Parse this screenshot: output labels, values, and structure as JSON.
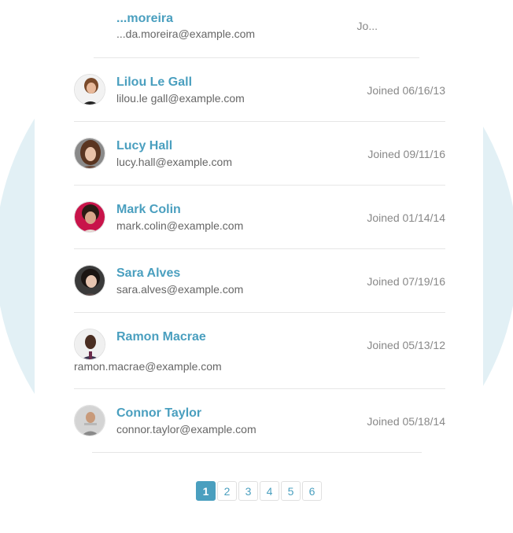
{
  "users": [
    {
      "name": "...moreira",
      "email": "...da.moreira@example.com",
      "joined": "Jo..."
    },
    {
      "name": "Lilou Le Gall",
      "email": "lilou.le gall@example.com",
      "joined": "Joined 06/16/13"
    },
    {
      "name": "Lucy Hall",
      "email": "lucy.hall@example.com",
      "joined": "Joined 09/11/16"
    },
    {
      "name": "Mark Colin",
      "email": "mark.colin@example.com",
      "joined": "Joined 01/14/14"
    },
    {
      "name": "Sara Alves",
      "email": "sara.alves@example.com",
      "joined": "Joined 07/19/16"
    },
    {
      "name": "Ramon Macrae",
      "email": "ramon.macrae@example.com",
      "joined": "Joined 05/13/12"
    },
    {
      "name": "Connor Taylor",
      "email": "connor.taylor@example.com",
      "joined": "Joined 05/18/14"
    }
  ],
  "pagination": {
    "pages": [
      "1",
      "2",
      "3",
      "4",
      "5",
      "6"
    ],
    "current": "1"
  },
  "colors": {
    "accent": "#4a9fbf",
    "background_circle": "#e2f0f5"
  }
}
